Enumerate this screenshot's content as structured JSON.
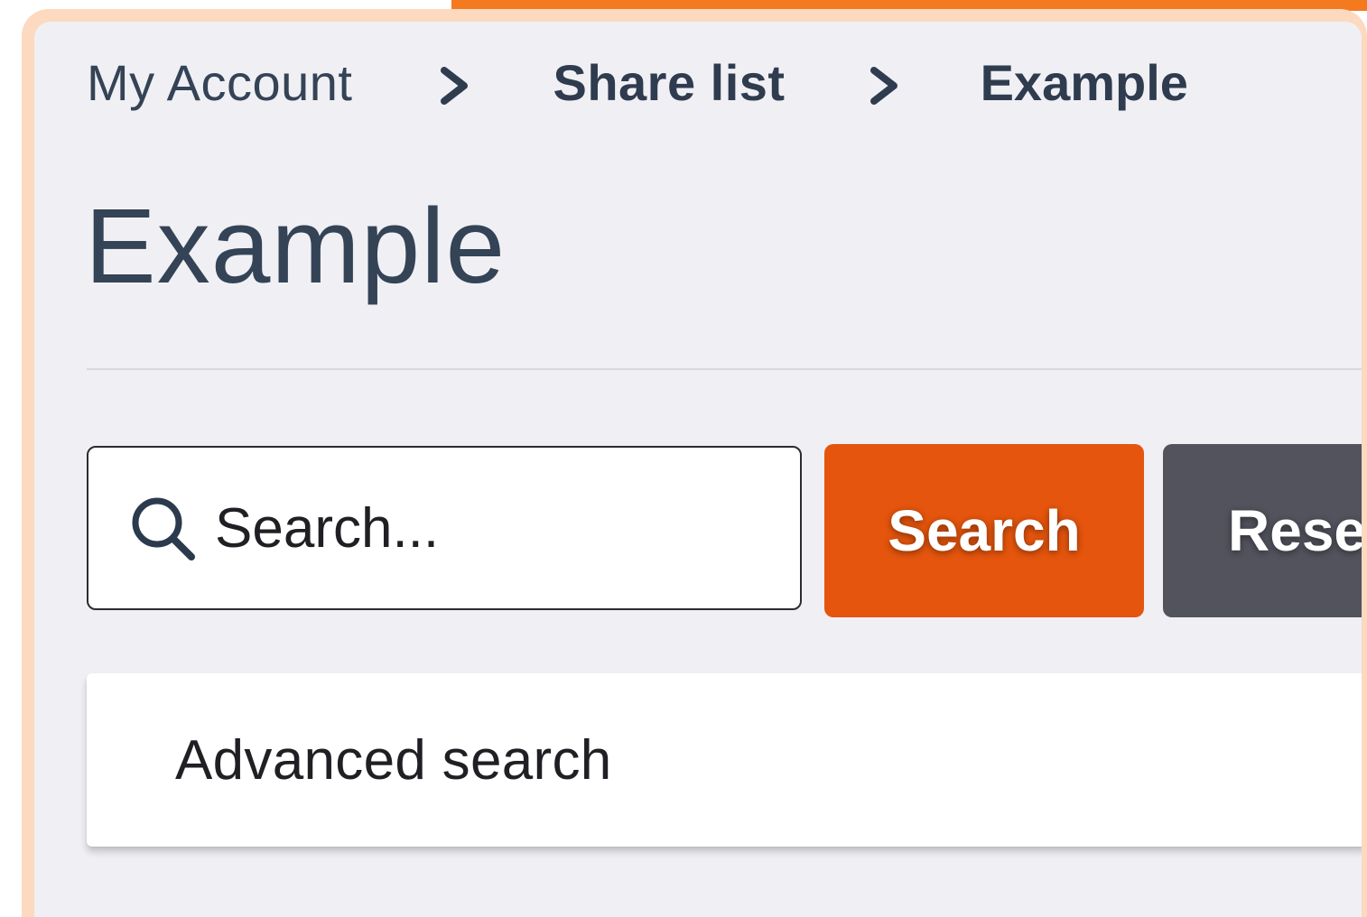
{
  "breadcrumb": {
    "items": [
      "My Account",
      "Share list",
      "Example"
    ]
  },
  "page": {
    "title": "Example"
  },
  "search": {
    "placeholder": "Search...",
    "value": "",
    "search_button_label": "Search",
    "reset_button_label": "Rese"
  },
  "advanced": {
    "label": "Advanced search"
  },
  "colors": {
    "accent": "#f47a1f",
    "search_button": "#e5550d",
    "reset_button": "#52535d",
    "frame": "#fdd9bf",
    "panel_bg": "#f0f0f4",
    "text": "#344356"
  },
  "icons": {
    "breadcrumb_separator": "chevron-right-icon",
    "search": "search-icon"
  }
}
